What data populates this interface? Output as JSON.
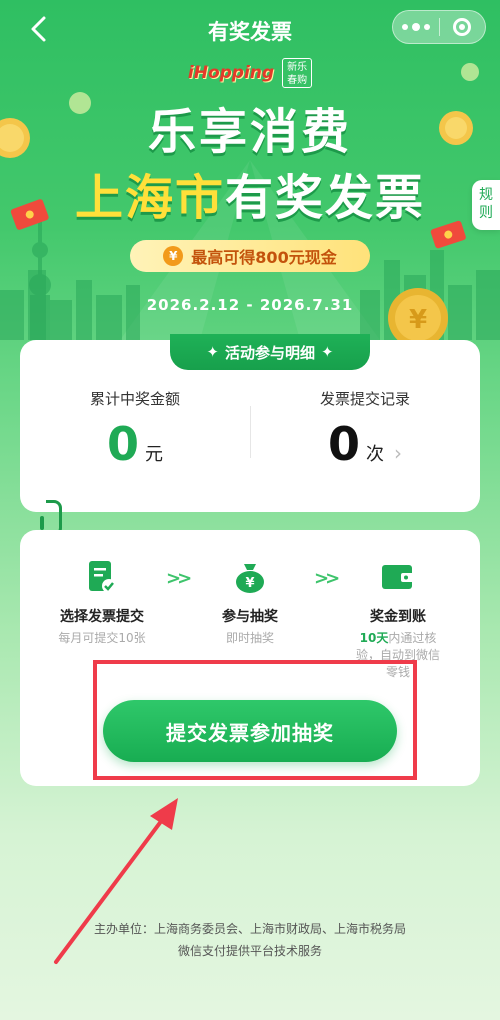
{
  "header": {
    "title": "有奖发票"
  },
  "logos": {
    "brand": "iHopping",
    "stamp_line1": "新乐",
    "stamp_line2": "春购"
  },
  "hero": {
    "title_line1": "乐享消费",
    "title_line2_highlight": "上海市",
    "title_line2_rest": "有奖发票",
    "coin_symbol": "¥",
    "prize_text": "最高可得800元现金",
    "date_range": "2026.2.12 - 2026.7.31"
  },
  "rules": {
    "label_line1": "规",
    "label_line2": "则"
  },
  "activity": {
    "banner": "活动参与明细",
    "total_prize_label": "累计中奖金额",
    "total_prize_value": "0",
    "total_prize_unit": "元",
    "submit_record_label": "发票提交记录",
    "submit_record_value": "0",
    "submit_record_unit": "次"
  },
  "steps": [
    {
      "title": "选择发票提交",
      "sub": "每月可提交10张"
    },
    {
      "title": "参与抽奖",
      "sub": "即时抽奖"
    },
    {
      "title": "奖金到账",
      "sub_highlight": "10天",
      "sub_line1": "内通过核",
      "sub_line2": "验，自动到微信",
      "sub_line3": "零钱"
    }
  ],
  "submit_button": "提交发票参加抽奖",
  "footer": {
    "organizers": "主办单位：上海商务委员会、上海市财政局、上海市税务局",
    "tech": "微信支付提供平台技术服务"
  },
  "colors": {
    "brand_green": "#1faa55",
    "highlight_yellow": "#ffe03a",
    "annotation_red": "#ef3b4a"
  }
}
